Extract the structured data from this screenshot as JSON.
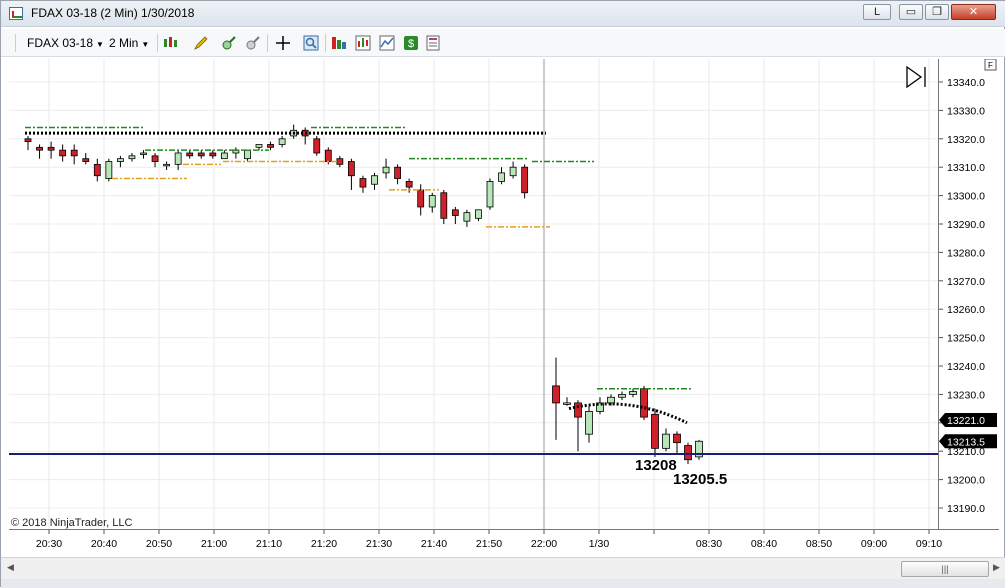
{
  "window": {
    "title": "FDAX 03-18 (2 Min)  1/30/2018",
    "buttons": {
      "l": "L",
      "minimize": "▭",
      "restore": "❐",
      "close": "✕"
    }
  },
  "toolbar": {
    "instrument": "FDAX 03-18",
    "interval": "2 Min"
  },
  "chart": {
    "copyright": "© 2018 NinjaTrader, LLC",
    "price_ticks": [
      "13340.0",
      "13330.0",
      "13320.0",
      "13310.0",
      "13300.0",
      "13290.0",
      "13280.0",
      "13270.0",
      "13260.0",
      "13250.0",
      "13240.0",
      "13230.0",
      "13220.0",
      "13210.0",
      "13200.0",
      "13190.0"
    ],
    "time_ticks": [
      "20:30",
      "20:40",
      "20:50",
      "21:00",
      "21:10",
      "21:20",
      "21:30",
      "21:40",
      "21:50",
      "22:00",
      "1/30",
      "08:30",
      "08:40",
      "08:50",
      "09:00",
      "09:10"
    ],
    "last_price_label": "13213.5",
    "cursor_price_label": "13221.0",
    "annotation_low1": "13208",
    "annotation_low2": "13205.5",
    "horizontal_line_price": 13209,
    "colors": {
      "up": "#b8e6b8",
      "down": "#d0202a",
      "hline": "#1a1a7a",
      "pivot_green": "#1f8a1f",
      "pivot_orange": "#e0a020"
    }
  },
  "chart_data": {
    "type": "candlestick",
    "ylim": [
      13185,
      13345
    ],
    "session1": {
      "bars": [
        {
          "o": 13320,
          "h": 13321,
          "l": 13316,
          "c": 13319
        },
        {
          "o": 13317,
          "h": 13318,
          "l": 13313,
          "c": 13316
        },
        {
          "o": 13317,
          "h": 13319,
          "l": 13313,
          "c": 13316
        },
        {
          "o": 13316,
          "h": 13318,
          "l": 13312,
          "c": 13314
        },
        {
          "o": 13316,
          "h": 13318,
          "l": 13311,
          "c": 13314
        },
        {
          "o": 13313,
          "h": 13315,
          "l": 13311,
          "c": 13312
        },
        {
          "o": 13311,
          "h": 13313,
          "l": 13305,
          "c": 13307
        },
        {
          "o": 13306,
          "h": 13313,
          "l": 13305,
          "c": 13312
        },
        {
          "o": 13312,
          "h": 13314,
          "l": 13310,
          "c": 13313
        },
        {
          "o": 13313,
          "h": 13315,
          "l": 13312,
          "c": 13314
        },
        {
          "o": 13315,
          "h": 13316,
          "l": 13313,
          "c": 13315
        },
        {
          "o": 13314,
          "h": 13315,
          "l": 13310,
          "c": 13312
        },
        {
          "o": 13311,
          "h": 13312,
          "l": 13309,
          "c": 13311
        },
        {
          "o": 13311,
          "h": 13316,
          "l": 13309,
          "c": 13315
        },
        {
          "o": 13315,
          "h": 13316,
          "l": 13313,
          "c": 13314
        },
        {
          "o": 13315,
          "h": 13316,
          "l": 13313,
          "c": 13314
        },
        {
          "o": 13315,
          "h": 13316,
          "l": 13313,
          "c": 13314
        },
        {
          "o": 13313,
          "h": 13316,
          "l": 13313,
          "c": 13315
        },
        {
          "o": 13315,
          "h": 13317,
          "l": 13313,
          "c": 13316
        },
        {
          "o": 13313,
          "h": 13316,
          "l": 13312,
          "c": 13316
        },
        {
          "o": 13317,
          "h": 13318,
          "l": 13316,
          "c": 13318
        },
        {
          "o": 13318,
          "h": 13319,
          "l": 13316,
          "c": 13317
        },
        {
          "o": 13318,
          "h": 13321,
          "l": 13317,
          "c": 13320
        },
        {
          "o": 13321,
          "h": 13325,
          "l": 13320,
          "c": 13323
        },
        {
          "o": 13323,
          "h": 13324,
          "l": 13318,
          "c": 13321
        },
        {
          "o": 13320,
          "h": 13321,
          "l": 13314,
          "c": 13315
        },
        {
          "o": 13316,
          "h": 13317,
          "l": 13311,
          "c": 13312
        },
        {
          "o": 13313,
          "h": 13314,
          "l": 13310,
          "c": 13311
        },
        {
          "o": 13312,
          "h": 13313,
          "l": 13302,
          "c": 13307
        },
        {
          "o": 13306,
          "h": 13307,
          "l": 13301,
          "c": 13303
        },
        {
          "o": 13304,
          "h": 13308,
          "l": 13302,
          "c": 13307
        },
        {
          "o": 13308,
          "h": 13313,
          "l": 13306,
          "c": 13310
        },
        {
          "o": 13310,
          "h": 13311,
          "l": 13304,
          "c": 13306
        },
        {
          "o": 13305,
          "h": 13306,
          "l": 13301,
          "c": 13303
        },
        {
          "o": 13302,
          "h": 13304,
          "l": 13293,
          "c": 13296
        },
        {
          "o": 13296,
          "h": 13301,
          "l": 13294,
          "c": 13300
        },
        {
          "o": 13301,
          "h": 13302,
          "l": 13290,
          "c": 13292
        },
        {
          "o": 13295,
          "h": 13296,
          "l": 13290,
          "c": 13293
        },
        {
          "o": 13291,
          "h": 13295,
          "l": 13289,
          "c": 13294
        },
        {
          "o": 13292,
          "h": 13295,
          "l": 13291,
          "c": 13295
        },
        {
          "o": 13296,
          "h": 13306,
          "l": 13295,
          "c": 13305
        },
        {
          "o": 13305,
          "h": 13310,
          "l": 13304,
          "c": 13308
        },
        {
          "o": 13307,
          "h": 13312,
          "l": 13306,
          "c": 13310
        },
        {
          "o": 13310,
          "h": 13311,
          "l": 13299,
          "c": 13301
        }
      ]
    },
    "session2": {
      "bars": [
        {
          "o": 13233,
          "h": 13243,
          "l": 13214,
          "c": 13227
        },
        {
          "o": 13227,
          "h": 13229,
          "l": 13226,
          "c": 13227
        },
        {
          "o": 13227,
          "h": 13228,
          "l": 13210,
          "c": 13222
        },
        {
          "o": 13216,
          "h": 13226,
          "l": 13213,
          "c": 13224
        },
        {
          "o": 13224,
          "h": 13229,
          "l": 13223,
          "c": 13227
        },
        {
          "o": 13227,
          "h": 13230,
          "l": 13226,
          "c": 13229
        },
        {
          "o": 13229,
          "h": 13231,
          "l": 13228,
          "c": 13230
        },
        {
          "o": 13230,
          "h": 13232,
          "l": 13229,
          "c": 13231
        },
        {
          "o": 13232,
          "h": 13233,
          "l": 13221,
          "c": 13222
        },
        {
          "o": 13223,
          "h": 13225,
          "l": 13208,
          "c": 13211
        },
        {
          "o": 13211,
          "h": 13218,
          "l": 13210,
          "c": 13216
        },
        {
          "o": 13216,
          "h": 13217,
          "l": 13209,
          "c": 13213
        },
        {
          "o": 13212,
          "h": 13213,
          "l": 13205.5,
          "c": 13207
        },
        {
          "o": 13208,
          "h": 13214,
          "l": 13207,
          "c": 13213.5
        }
      ]
    }
  }
}
